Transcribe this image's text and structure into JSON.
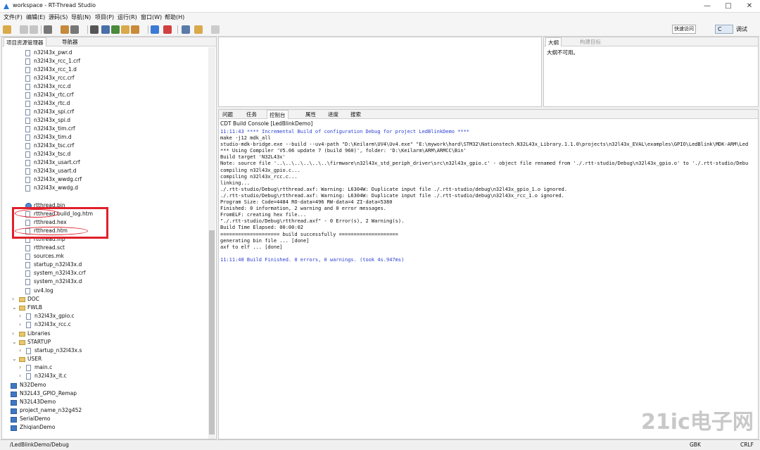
{
  "window": {
    "title": "workspace - RT-Thread Studio",
    "minimize": "—",
    "maximize": "□",
    "close": "✕"
  },
  "menu": [
    "文件(F)",
    "编辑(E)",
    "源码(S)",
    "导航(N)",
    "项目(P)",
    "运行(R)",
    "窗口(W)",
    "帮助(H)"
  ],
  "toolbar": {
    "quick_access": "快速访问",
    "persp_c": "C",
    "persp_debug": "调试"
  },
  "explorer": {
    "tabs": [
      "项目资源管理器",
      "导航器"
    ],
    "files": [
      "n32l43x_pwr.d",
      "n32l43x_rcc_1.crf",
      "n32l43x_rcc_1.d",
      "n32l43x_rcc.crf",
      "n32l43x_rcc.d",
      "n32l43x_rtc.crf",
      "n32l43x_rtc.d",
      "n32l43x_spi.crf",
      "n32l43x_spi.d",
      "n32l43x_tim.crf",
      "n32l43x_tim.d",
      "n32l43x_tsc.crf",
      "n32l43x_tsc.d",
      "n32l43x_usart.crf",
      "n32l43x_usart.d",
      "n32l43x_wwdg.crf",
      "n32l43x_wwdg.d"
    ],
    "highlighted": [
      "rtthread.bin",
      "rtthread.build_log.htm",
      "rtthread.hex"
    ],
    "after_files": [
      "rtthread.htm",
      "rtthread.lnp",
      "rtthread.sct",
      "sources.mk",
      "startup_n32l43x.d",
      "system_n32l43x.crf",
      "system_n32l43x.d",
      "uv4.log"
    ],
    "folders": {
      "doc": "DOC",
      "fwlb": "FWLB",
      "fwlb_children": [
        "n32l43x_gpio.c",
        "n32l43x_rcc.c"
      ],
      "libraries": "Libraries",
      "startup": "STARTUP",
      "startup_children": [
        "startup_n32l43x.s"
      ],
      "user": "USER",
      "user_children": [
        "main.c",
        "n32l43x_it.c"
      ]
    },
    "projects": [
      "N32Demo",
      "N32L43_GPIO_Remap",
      "N32L43Demo",
      "project_name_n32g452",
      "SerialDemo",
      "ZhiqianDemo"
    ]
  },
  "outline": {
    "tabs": [
      "大纲",
      "构建目标"
    ],
    "message": "大纲不可用。"
  },
  "console": {
    "tabs": [
      "问题",
      "任务",
      "控制台",
      "属性",
      "进度",
      "搜索"
    ],
    "title": "CDT Build Console [LedBlinkDemo]",
    "lines": [
      {
        "t": "11:11:43 **** Incremental Build of configuration Debug for project LedBlinkDemo ****",
        "blue": true
      },
      {
        "t": "make -j12 mdk_all"
      },
      {
        "t": "studio-mdk-bridge.exe --build --uv4-path \"D:\\Keilarm\\UV4\\Uv4.exe\" \"E:\\mywork\\hard\\STM32\\Nationstech.N32L43x_Library.1.1.0\\projects\\n32l43x_EVAL\\examples\\GPIO\\LedBlink\\MDK-ARM\\Led"
      },
      {
        "t": "*** Using Compiler 'V5.06 update 7 (build 960)', folder: 'D:\\Keilarm\\ARM\\ARMCC\\Bin'"
      },
      {
        "t": "Build target 'N32L43x'"
      },
      {
        "t": "Note: source file '..\\..\\..\\..\\..\\..\\firmware\\n32l43x_std_periph_driver\\src\\n32l43x_gpio.c' - object file renamed from './.rtt-studio/Debug\\n32l43x_gpio.o' to './.rtt-studio/Debu"
      },
      {
        "t": "compiling n32l43x_gpio.c..."
      },
      {
        "t": "compiling n32l43x_rcc.c..."
      },
      {
        "t": "linking..."
      },
      {
        "t": "./.rtt-studio/Debug\\rtthread.axf: Warning: L6304W: Duplicate input file ./.rtt-studio/debug\\n32l43x_gpio_1.o ignored."
      },
      {
        "t": "./.rtt-studio/Debug\\rtthread.axf: Warning: L6304W: Duplicate input file ./.rtt-studio/debug\\n32l43x_rcc_1.o ignored."
      },
      {
        "t": "Program Size: Code=4484 RO-data=496 RW-data=4 ZI-data=5380"
      },
      {
        "t": "Finished: 0 information, 2 warning and 0 error messages."
      },
      {
        "t": "FromELF: creating hex file..."
      },
      {
        "t": "\"./.rtt-studio/Debug\\rtthread.axf\" - 0 Error(s), 2 Warning(s)."
      },
      {
        "t": "Build Time Elapsed:  00:00:02"
      },
      {
        "t": "==================== build successfully ===================="
      },
      {
        "t": "generating bin file ... [done]"
      },
      {
        "t": "axf to elf ...  [done]"
      },
      {
        "t": ""
      },
      {
        "t": "11:11:48 Build Finished. 0 errors, 0 warnings. (took 4s.947ms)",
        "blue": true
      }
    ]
  },
  "status": {
    "path": "/LedBlinkDemo/Debug",
    "encoding": "GBK",
    "eol": "CRLF"
  },
  "watermark": "21ic电子网"
}
